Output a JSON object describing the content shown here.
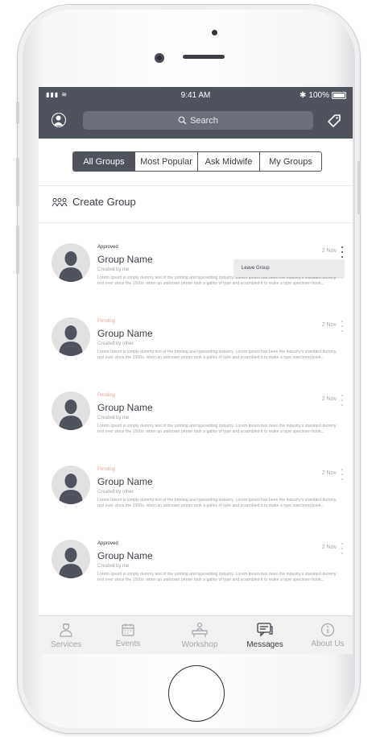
{
  "status_bar": {
    "time": "9:41 AM",
    "battery": "100%"
  },
  "navbar": {
    "search_placeholder": "Search"
  },
  "segments": [
    {
      "label": "All Groups"
    },
    {
      "label": "Most Popular"
    },
    {
      "label": "Ask Midwife"
    },
    {
      "label": "My Groups"
    }
  ],
  "create_group": {
    "label": "Create Group"
  },
  "groups": [
    {
      "status": "Approved",
      "name": "Group Name",
      "creator": "Created by me",
      "date": "2 Nov",
      "description": "Lorem Ipsum is simply dummy text of the printing and typesetting industry. Lorem Ipsum has been the industry's standard dummy text ever since the 1500s, when an unknown printer took a galley of type and scrambled it to make a type specimen book..."
    },
    {
      "status": "Pending",
      "name": "Group Name",
      "creator": "Created by other",
      "date": "2 Nov",
      "description": "Lorem Ipsum is simply dummy text of the printing and typesetting industry. Lorem Ipsum has been the industry's standard dummy text ever since the 1500s, when an unknown printer took a galley of type and scrambled it to make a type specimen book..."
    },
    {
      "status": "Pending",
      "name": "Group Name",
      "creator": "Created by me",
      "date": "2 Nov",
      "description": "Lorem Ipsum is simply dummy text of the printing and typesetting industry. Lorem Ipsum has been the industry's standard dummy text ever since the 1500s, when an unknown printer took a galley of type and scrambled it to make a type specimen book..."
    },
    {
      "status": "Pending",
      "name": "Group Name",
      "creator": "Created by other",
      "date": "2 Nov",
      "description": "Lorem Ipsum is simply dummy text of the printing and typesetting industry. Lorem Ipsum has been the industry's standard dummy text ever since the 1500s, when an unknown printer took a galley of type and scrambled it to make a type specimen book..."
    },
    {
      "status": "Approved",
      "name": "Group Name",
      "creator": "Created by me",
      "date": "2 Nov",
      "description": "Lorem Ipsum is simply dummy text of the printing and typesetting industry. Lorem Ipsum has been the industry's standard dummy text ever since the 1500s, when an unknown printer took a galley of type and scrambled it to make a type specimen book..."
    }
  ],
  "context_menu": {
    "leave_label": "Leave Group"
  },
  "tab_bar": [
    {
      "label": "Services",
      "icon": "services-icon",
      "active": false
    },
    {
      "label": "Events",
      "icon": "calendar-icon",
      "active": false
    },
    {
      "label": "Workshop",
      "icon": "workshop-icon",
      "active": false
    },
    {
      "label": "Messages",
      "icon": "messages-icon",
      "active": true
    },
    {
      "label": "About Us",
      "icon": "info-icon",
      "active": false
    }
  ],
  "colors": {
    "header": "#4f535e",
    "approved": "#2f323a",
    "pending": "#e9a593",
    "muted": "#9fa2a9"
  }
}
